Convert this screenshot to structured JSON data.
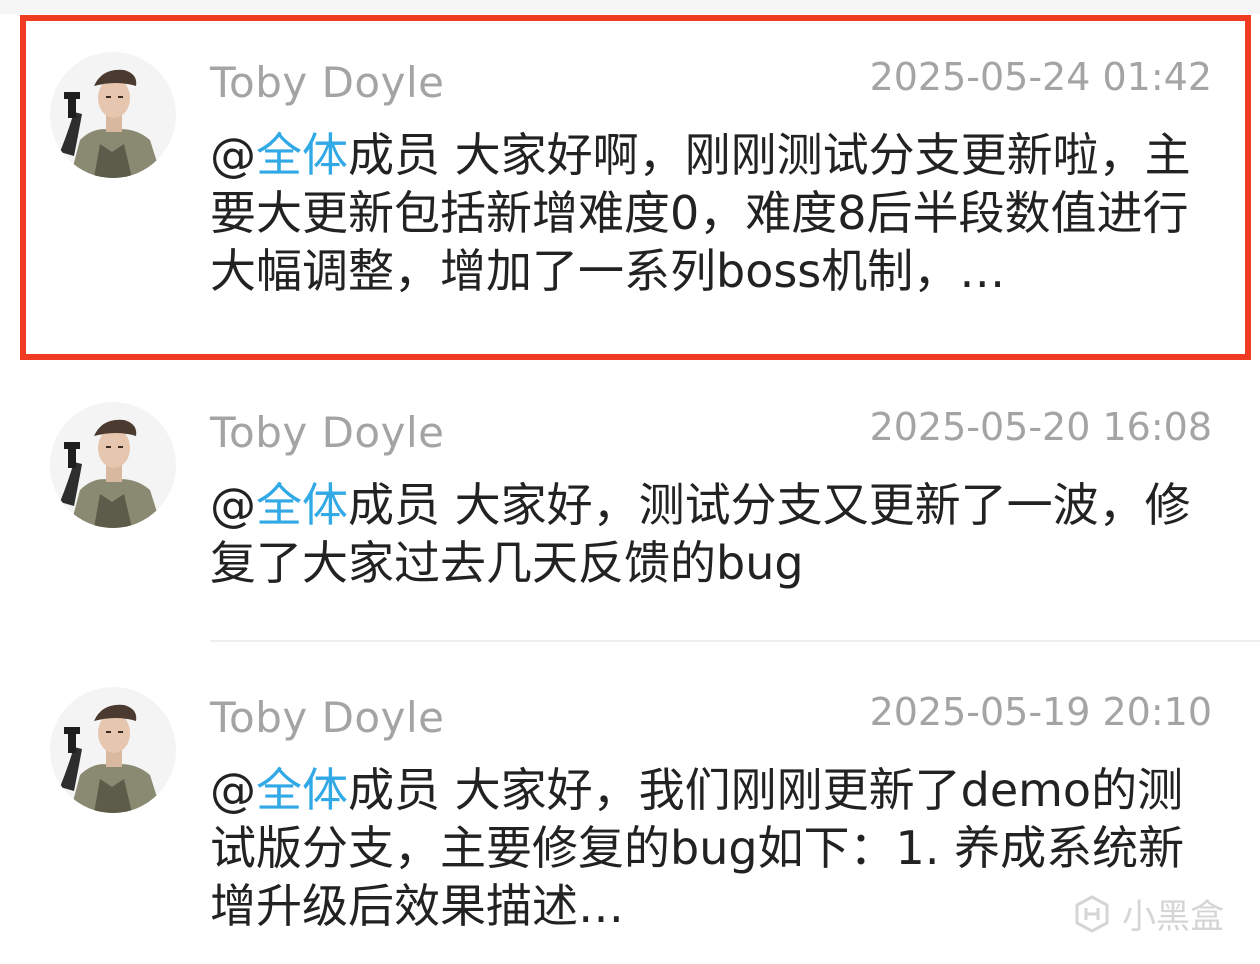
{
  "messages": [
    {
      "author": "Toby Doyle",
      "time": "2025-05-24 01:42",
      "mention_at": "@",
      "mention_name": "全体",
      "body": "成员  大家好啊，刚刚测试分支更新啦，主要大更新包括新增难度0，难度8后半段数值进行大幅调整，增加了一系列boss机制，…",
      "highlighted": true
    },
    {
      "author": "Toby Doyle",
      "time": "2025-05-20 16:08",
      "mention_at": "@",
      "mention_name": "全体",
      "body": "成员  大家好，测试分支又更新了一波，修复了大家过去几天反馈的bug",
      "highlighted": false
    },
    {
      "author": "Toby Doyle",
      "time": "2025-05-19 20:10",
      "mention_at": "@",
      "mention_name": "全体",
      "body": "成员  大家好，我们刚刚更新了demo的测试版分支，主要修复的bug如下：1. 养成系统新增升级后效果描述…",
      "highlighted": false
    }
  ],
  "watermark": {
    "text": "小黑盒",
    "icon": "heybox-logo-icon"
  },
  "colors": {
    "highlight_border": "#ee3b22",
    "mention": "#31a9e6",
    "meta_text": "#a4a4a4",
    "body_text": "#222222"
  }
}
